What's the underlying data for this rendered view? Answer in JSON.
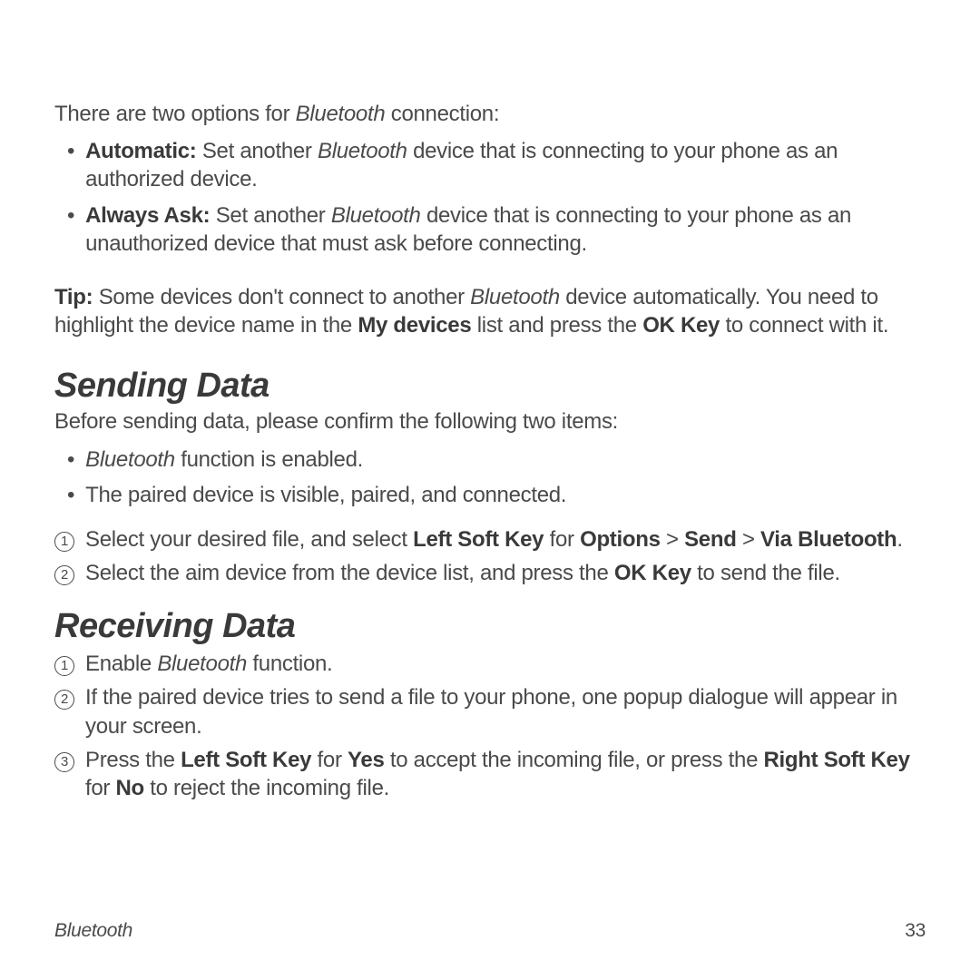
{
  "intro": {
    "prefix": "There are two options for ",
    "italic": "Bluetooth",
    "suffix": " connection:"
  },
  "options": {
    "automatic": {
      "label": "Automatic:",
      "prefix": " Set another ",
      "italic": "Bluetooth",
      "suffix": " device that is connecting to your phone as an authorized device."
    },
    "alwaysAsk": {
      "label": "Always Ask:",
      "prefix": " Set another ",
      "italic": "Bluetooth",
      "suffix": " device that is connecting to your phone as an unauthorized device that must ask before connecting."
    }
  },
  "tip": {
    "label": "Tip:",
    "prefix": " Some devices don't connect to another ",
    "italic": "Bluetooth",
    "mid1": " device automatically. You need to highlight the device name in the ",
    "bold1": "My devices",
    "mid2": " list and press the ",
    "bold2": "OK Key",
    "suffix": " to connect with it."
  },
  "sending": {
    "heading": "Sending Data",
    "intro": "Before sending data, please confirm the following two items:",
    "bullet1": {
      "italic": "Bluetooth",
      "suffix": " function is enabled."
    },
    "bullet2": "The paired device is visible, paired, and connected.",
    "step1": {
      "num": "1",
      "prefix": "Select your desired file, and select ",
      "bold1": "Left Soft Key",
      "mid1": " for ",
      "bold2": "Options",
      "mid2": " > ",
      "bold3": "Send",
      "mid3": " > ",
      "bold4": "Via Bluetooth",
      "suffix": "."
    },
    "step2": {
      "num": "2",
      "prefix": "Select the aim device from the device list, and press the ",
      "bold1": "OK Key",
      "suffix": " to send the file."
    }
  },
  "receiving": {
    "heading": "Receiving Data",
    "step1": {
      "num": "1",
      "prefix": "Enable ",
      "italic": "Bluetooth",
      "suffix": " function."
    },
    "step2": {
      "num": "2",
      "text": "If the paired device tries to send a file to your phone, one popup dialogue will appear in your screen."
    },
    "step3": {
      "num": "3",
      "prefix": "Press the ",
      "bold1": "Left Soft Key",
      "mid1": " for ",
      "bold2": "Yes",
      "mid2": " to accept the incoming file, or press the ",
      "bold3": "Right Soft Key",
      "mid3": " for ",
      "bold4": "No",
      "suffix": " to reject the incoming file."
    }
  },
  "footer": {
    "section": "Bluetooth",
    "page": "33"
  }
}
